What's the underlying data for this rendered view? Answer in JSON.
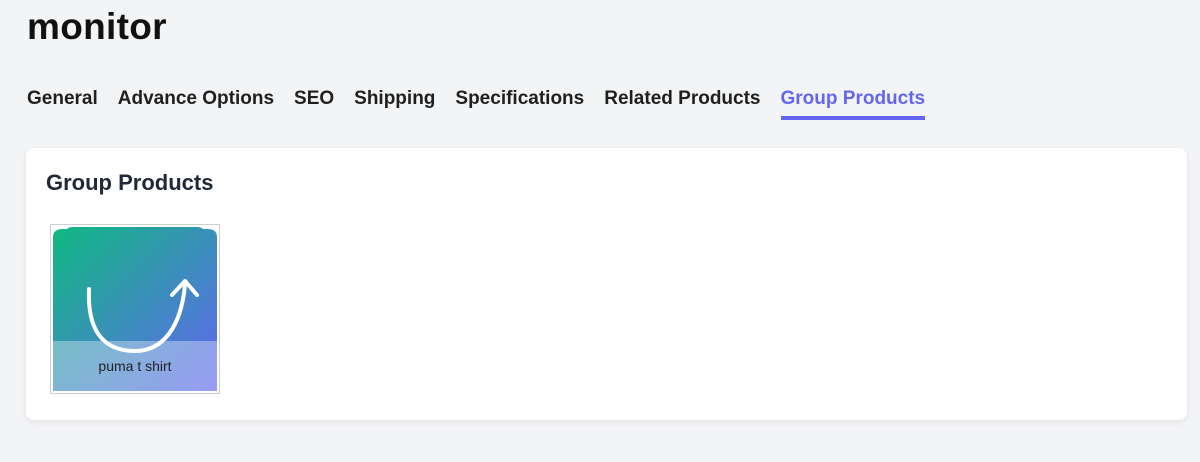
{
  "page": {
    "title": "monitor"
  },
  "tabs": [
    {
      "label": "General",
      "active": false
    },
    {
      "label": "Advance Options",
      "active": false
    },
    {
      "label": "SEO",
      "active": false
    },
    {
      "label": "Shipping",
      "active": false
    },
    {
      "label": "Specifications",
      "active": false
    },
    {
      "label": "Related Products",
      "active": false
    },
    {
      "label": "Group Products",
      "active": true
    }
  ],
  "group_products": {
    "title": "Group Products",
    "items": [
      {
        "name": "puma t shirt",
        "icon": "shopping-bag-logo-icon"
      }
    ]
  },
  "colors": {
    "accent": "#6366f1",
    "gradient_start": "#10b981",
    "gradient_end": "#6366f1"
  }
}
